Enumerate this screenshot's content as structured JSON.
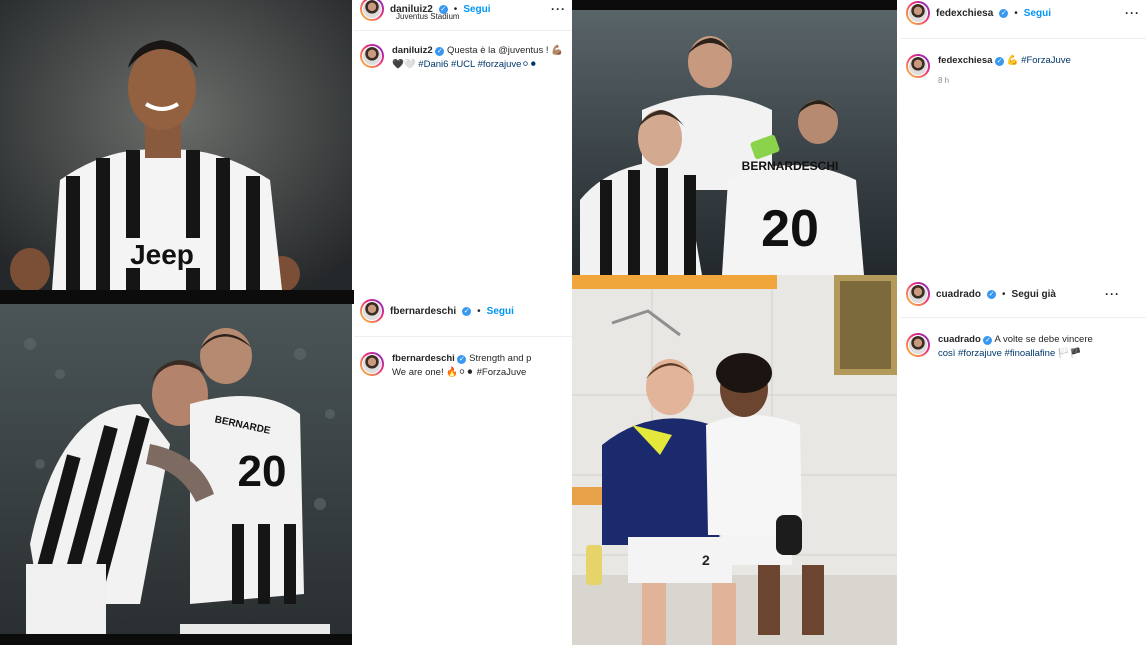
{
  "posts": [
    {
      "username": "daniluiz2",
      "follow_label": "Segui",
      "location": "Juventus Stadium",
      "caption_user": "daniluiz2",
      "caption_text": "Questa è la @juventus ! 💪🏽",
      "caption_line2": "🖤🤍 #Dani6 #UCL #forzajuve⚪⚫"
    },
    {
      "username": "fedexchiesa",
      "follow_label": "Segui",
      "caption_user": "fedexchiesa",
      "caption_text": "💪 #ForzaJuve",
      "time": "8 h"
    },
    {
      "username": "fbernardeschi",
      "follow_label": "Segui",
      "caption_user": "fbernardeschi",
      "caption_text": "Strength and p",
      "caption_line2": "We are one! 🔥⚪⚫ #ForzaJuve"
    },
    {
      "username": "cuadrado",
      "follow_label": "Segui già",
      "caption_user": "cuadrado",
      "caption_text": "A volte se debe vincere",
      "caption_line2": "così #forzajuve #finoallafine 🏳️🏴"
    }
  ],
  "photos": {
    "danilo_number": "",
    "bernardeschi_name": "BERNARDESCHI",
    "bernardeschi_number": "20",
    "hug_number": "20",
    "hug_name": "BERNARDE",
    "sponsor": "Jeep",
    "bench_number": "2"
  },
  "colors": {
    "link": "#0095f6",
    "verified": "#3897f0",
    "hashtag": "#00376b",
    "muted": "#8e8e8e"
  }
}
